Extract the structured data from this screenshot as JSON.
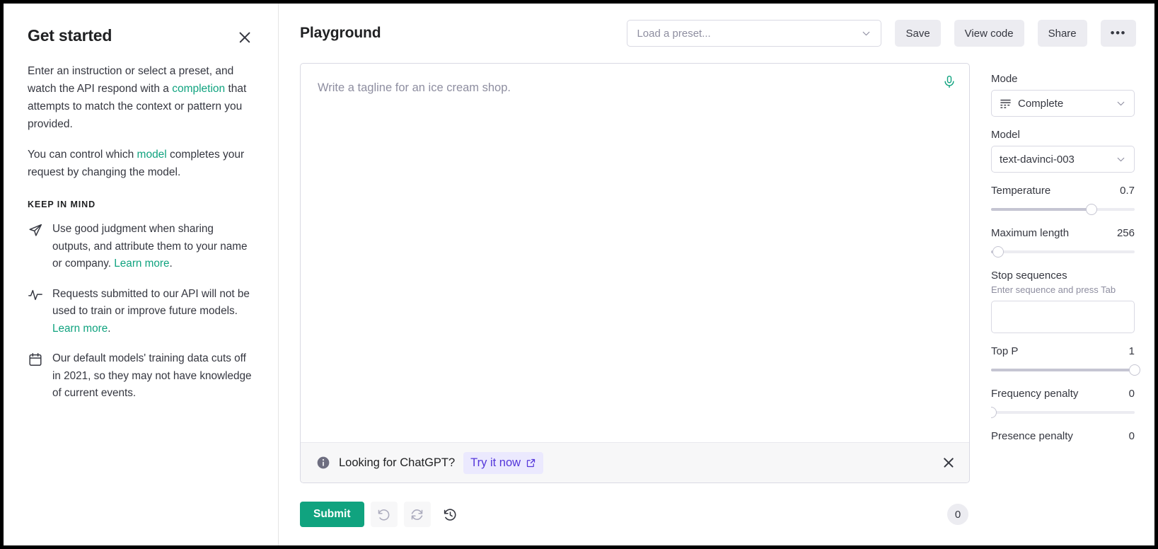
{
  "sidebar": {
    "title": "Get started",
    "close_icon": "close-icon",
    "paragraph1": {
      "pre": "Enter an instruction or select a preset, and watch the API respond with a ",
      "link": "completion",
      "post": " that attempts to match the context or pattern you provided."
    },
    "paragraph2": {
      "pre": "You can control which ",
      "link": "model",
      "post": " completes your request by changing the model."
    },
    "keep_in_mind_title": "KEEP IN MIND",
    "items": [
      {
        "icon": "paper-plane-icon",
        "pre": "Use good judgment when sharing outputs, and attribute them to your name or company. ",
        "link": "Learn more",
        "post": "."
      },
      {
        "icon": "activity-pulse-icon",
        "pre": "Requests submitted to our API will not be used to train or improve future models. ",
        "link": "Learn more",
        "post": "."
      },
      {
        "icon": "calendar-icon",
        "pre": "Our default models' training data cuts off in 2021, so they may not have knowledge of current events.",
        "link": "",
        "post": ""
      }
    ]
  },
  "topbar": {
    "page_title": "Playground",
    "preset_placeholder": "Load a preset...",
    "preset_chevron_icon": "chevron-down-icon",
    "save_label": "Save",
    "view_code_label": "View code",
    "share_label": "Share",
    "more_label": "•••"
  },
  "editor": {
    "placeholder": "Write a tagline for an ice cream shop.",
    "value": "",
    "mic_icon": "microphone-icon"
  },
  "chatgpt_banner": {
    "info_icon": "info-circle-icon",
    "message": "Looking for ChatGPT?",
    "cta_label": "Try it now",
    "cta_external_icon": "external-link-icon",
    "close_icon": "close-icon",
    "bg_color": "#f7f7f8",
    "cta_bg_color": "#ebe9fe",
    "cta_text_color": "#5436da"
  },
  "actions": {
    "submit_label": "Submit",
    "undo_icon": "undo-arrow-icon",
    "regenerate_icon": "refresh-icon",
    "history_icon": "history-clock-icon",
    "token_count": "0",
    "submit_color": "#10a37f"
  },
  "controls": {
    "mode": {
      "label": "Mode",
      "value": "Complete",
      "icon": "grid-list-icon",
      "chevron_icon": "chevron-down-icon"
    },
    "model": {
      "label": "Model",
      "value": "text-davinci-003",
      "chevron_icon": "chevron-down-icon"
    },
    "temperature": {
      "label": "Temperature",
      "value": "0.7",
      "percent": 70
    },
    "maximum_length": {
      "label": "Maximum length",
      "value": "256",
      "percent": 5
    },
    "stop_sequences": {
      "label": "Stop sequences",
      "hint": "Enter sequence and press Tab",
      "value": ""
    },
    "top_p": {
      "label": "Top P",
      "value": "1",
      "percent": 100
    },
    "frequency_penalty": {
      "label": "Frequency penalty",
      "value": "0",
      "percent": 0
    },
    "presence_penalty": {
      "label": "Presence penalty",
      "value": "0",
      "percent": 0
    }
  }
}
